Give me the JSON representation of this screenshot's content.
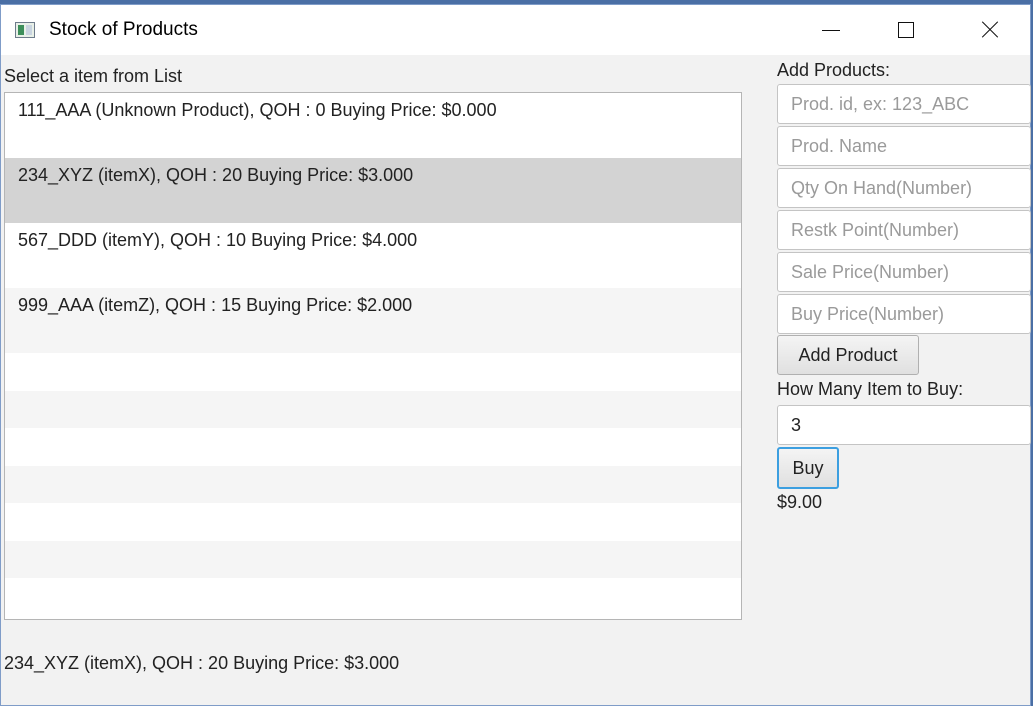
{
  "window": {
    "title": "Stock of Products",
    "icon": "app-window-icon"
  },
  "list": {
    "label": "Select a item from List",
    "items": [
      "111_AAA (Unknown Product), QOH : 0 Buying Price: $0.000",
      "234_XYZ (itemX), QOH : 20 Buying Price: $3.000",
      "567_DDD (itemY), QOH : 10 Buying Price: $4.000",
      "999_AAA (itemZ), QOH : 15 Buying Price: $2.000"
    ],
    "selected_index": 1
  },
  "add_form": {
    "heading": "Add Products:",
    "placeholders": {
      "prod_id": "Prod. id, ex: 123_ABC",
      "prod_name": "Prod. Name",
      "qty": "Qty On Hand(Number)",
      "restock": "Restk Point(Number)",
      "sale_price": "Sale Price(Number)",
      "buy_price": "Buy Price(Number)"
    },
    "add_button": "Add Product"
  },
  "buy_form": {
    "label": "How Many Item to Buy:",
    "quantity_value": "3",
    "buy_button": "Buy",
    "total": "$9.00"
  },
  "status": {
    "selected_text": "234_XYZ (itemX), QOH : 20 Buying Price: $3.000"
  }
}
